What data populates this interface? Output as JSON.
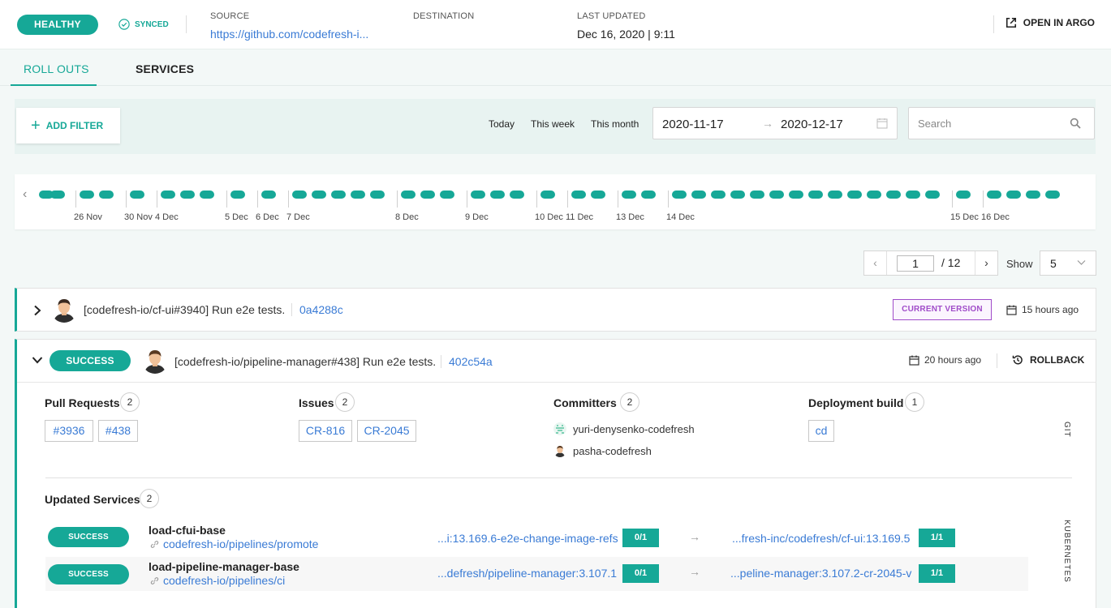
{
  "header": {
    "health": "HEALTHY",
    "sync": "SYNCED",
    "source_label": "SOURCE",
    "source_value": "https://github.com/codefresh-i...",
    "destination_label": "DESTINATION",
    "last_updated_label": "LAST UPDATED",
    "last_updated_value": "Dec 16, 2020 | 9:11",
    "open_argo": "OPEN IN ARGO"
  },
  "tabs": [
    {
      "label": "ROLL OUTS",
      "active": true
    },
    {
      "label": "SERVICES",
      "active": false
    }
  ],
  "filters": {
    "add_filter": "ADD FILTER",
    "quick": [
      "Today",
      "This week",
      "This month"
    ],
    "date_from": "2020-11-17",
    "date_to": "2020-12-17",
    "search_placeholder": "Search"
  },
  "timeline": {
    "dates": [
      "26 Nov",
      "30 Nov",
      "4 Dec",
      "5 Dec",
      "6 Dec",
      "7 Dec",
      "8 Dec",
      "9 Dec",
      "10 Dec",
      "11 Dec",
      "13 Dec",
      "14 Dec",
      "15 Dec",
      "16 Dec"
    ],
    "dot_color": "#16a897"
  },
  "pagination": {
    "page": "1",
    "total": "/ 12",
    "show_label": "Show",
    "page_size": "5"
  },
  "rollouts": [
    {
      "message": "[codefresh-io/cf-ui#3940] Run e2e tests.",
      "sha": "0a4288c",
      "badge": "CURRENT VERSION",
      "time": "15 hours ago"
    },
    {
      "status": "SUCCESS",
      "message": "[codefresh-io/pipeline-manager#438] Run e2e tests.",
      "sha": "402c54a",
      "time": "20 hours ago",
      "rollback": "ROLLBACK",
      "git": {
        "pull_requests": {
          "title": "Pull Requests",
          "count": "2",
          "items": [
            "#3936",
            "#438"
          ]
        },
        "issues": {
          "title": "Issues",
          "count": "2",
          "items": [
            "CR-816",
            "CR-2045"
          ]
        },
        "committers": {
          "title": "Committers",
          "count": "2",
          "items": [
            "yuri-denysenko-codefresh",
            "pasha-codefresh"
          ]
        },
        "deployment_build": {
          "title": "Deployment build",
          "count": "1",
          "items": [
            "cd"
          ]
        },
        "side_label": "GIT"
      },
      "services": {
        "title": "Updated Services",
        "count": "2",
        "side_label": "KUBERNETES",
        "items": [
          {
            "status": "SUCCESS",
            "name": "load-cfui-base",
            "pipeline": "codefresh-io/pipelines/promote",
            "from_image": "...i:13.169.6-e2e-change-image-refs",
            "from_ratio": "0/1",
            "arrow": "→",
            "to_image": "...fresh-inc/codefresh/cf-ui:13.169.5",
            "to_ratio": "1/1"
          },
          {
            "status": "SUCCESS",
            "name": "load-pipeline-manager-base",
            "pipeline": "codefresh-io/pipelines/ci",
            "from_image": "...defresh/pipeline-manager:3.107.1",
            "from_ratio": "0/1",
            "arrow": "→",
            "to_image": "...peline-manager:3.107.2-cr-2045-v",
            "to_ratio": "1/1"
          }
        ]
      }
    }
  ],
  "colors": {
    "accent": "#16a897",
    "link": "#3a7bd5",
    "current_version": "#a04cc9"
  }
}
